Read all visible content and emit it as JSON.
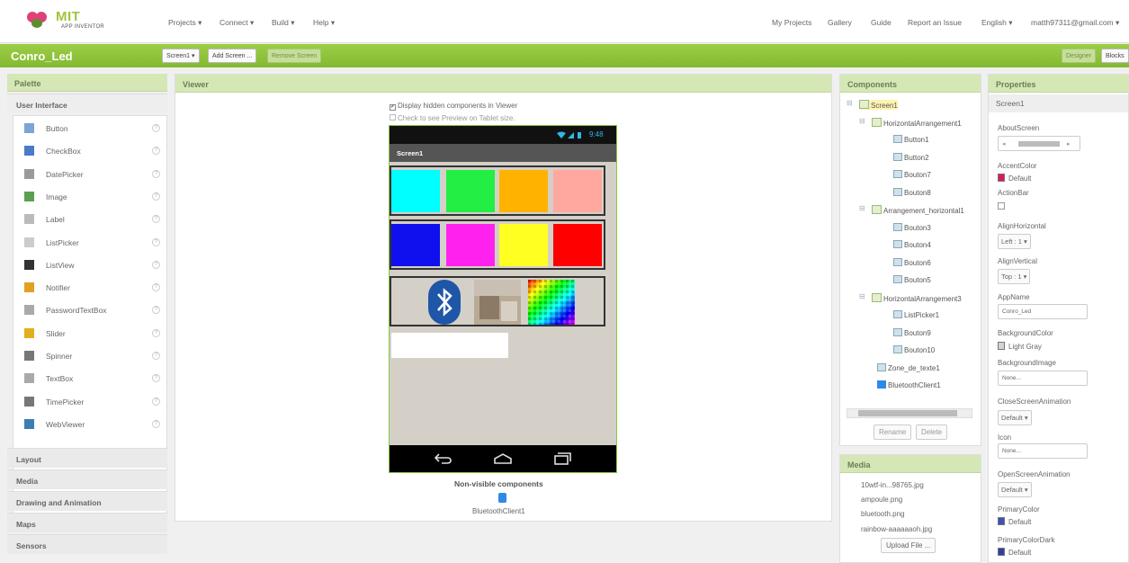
{
  "topbar": {
    "logo_text": "MIT",
    "logo_sub": "APP INVENTOR",
    "menu": [
      "Projects",
      "Connect",
      "Build",
      "Help"
    ],
    "right_links": [
      "My Projects",
      "Gallery",
      "Guide",
      "Report an Issue"
    ],
    "language": "English",
    "account": "matth97311@gmail.com"
  },
  "project": {
    "name": "Conro_Led",
    "screen_select": "Screen1",
    "add_screen": "Add Screen ...",
    "remove_screen": "Remove Screen",
    "designer": "Designer",
    "blocks": "Blocks"
  },
  "palette": {
    "title": "Palette",
    "section_ui": "User Interface",
    "items": [
      "Button",
      "CheckBox",
      "DatePicker",
      "Image",
      "Label",
      "ListPicker",
      "ListView",
      "Notifier",
      "PasswordTextBox",
      "Slider",
      "Spinner",
      "TextBox",
      "TimePicker",
      "WebViewer"
    ],
    "help_glyph": "?",
    "sections": [
      "Layout",
      "Media",
      "Drawing and Animation",
      "Maps",
      "Sensors"
    ]
  },
  "viewer": {
    "title": "Viewer",
    "display_hidden": "Display hidden components in Viewer",
    "tablet_preview": "Check to see Preview on Tablet size.",
    "phone_time": "9:48",
    "screen_title": "Screen1",
    "non_visible_label": "Non-visible components",
    "non_visible_item": "BluetoothClient1",
    "row1_colors": [
      "#00ffff",
      "#22ee44",
      "#ffb300",
      "#ffa8a0"
    ],
    "row2_colors": [
      "#1010ee",
      "#ff22ee",
      "#ffff22",
      "#ff0000"
    ]
  },
  "components": {
    "title": "Components",
    "tree": [
      "Screen1",
      "HorizontalArrangement1",
      "Button1",
      "Button2",
      "Bouton7",
      "Bouton8",
      "Arrangement_horizontal1",
      "Bouton3",
      "Bouton4",
      "Bouton6",
      "Bouton5",
      "HorizontalArrangement3",
      "ListPicker1",
      "Bouton9",
      "Bouton10",
      "Zone_de_texte1",
      "BluetoothClient1"
    ],
    "rename": "Rename",
    "delete": "Delete"
  },
  "media": {
    "title": "Media",
    "files": [
      "10wtf-in...98765.jpg",
      "ampoule.png",
      "bluetooth.png",
      "rainbow-aaaaaaoh.jpg"
    ],
    "upload": "Upload File ..."
  },
  "properties": {
    "title": "Properties",
    "component": "Screen1",
    "about_screen": "AboutScreen",
    "accent_color": "AccentColor",
    "accent_value": "Default",
    "accent_swatch": "#d81b60",
    "action_bar": "ActionBar",
    "align_h": "AlignHorizontal",
    "align_h_value": "Left : 1",
    "align_v": "AlignVertical",
    "align_v_value": "Top : 1",
    "app_name": "AppName",
    "app_name_value": "Conro_Led",
    "bg_color": "BackgroundColor",
    "bg_color_value": "Light Gray",
    "bg_swatch": "#d3d3d3",
    "bg_image": "BackgroundImage",
    "bg_image_value": "None...",
    "close_anim": "CloseScreenAnimation",
    "close_anim_value": "Default",
    "icon": "Icon",
    "icon_value": "None...",
    "open_anim": "OpenScreenAnimation",
    "open_anim_value": "Default",
    "primary": "PrimaryColor",
    "primary_value": "Default",
    "primary_swatch": "#3f51b5",
    "primary_dark": "PrimaryColorDark",
    "primary_dark_value": "Default",
    "primary_dark_swatch": "#303f9f"
  }
}
